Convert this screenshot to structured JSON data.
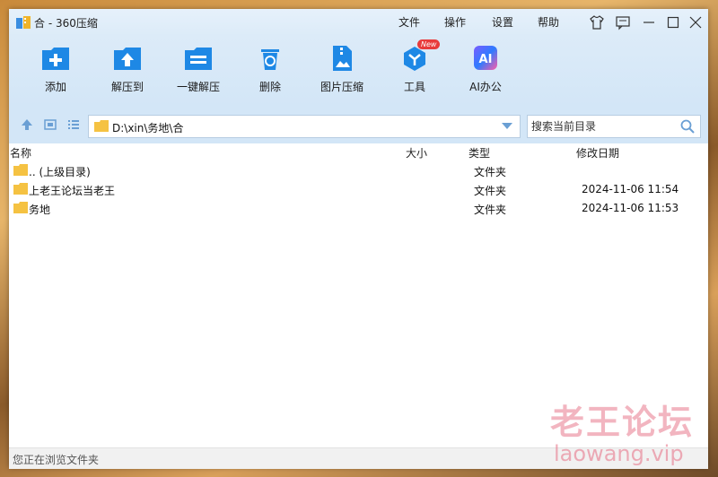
{
  "window": {
    "title": "合 - 360压缩",
    "menu": [
      "文件",
      "操作",
      "设置",
      "帮助"
    ]
  },
  "toolbar": {
    "items": [
      {
        "label": "添加",
        "icon": "add-icon"
      },
      {
        "label": "解压到",
        "icon": "extract-to-icon"
      },
      {
        "label": "一键解压",
        "icon": "one-click-extract-icon"
      },
      {
        "label": "删除",
        "icon": "delete-icon"
      },
      {
        "label": "图片压缩",
        "icon": "image-compress-icon"
      },
      {
        "label": "工具",
        "icon": "tools-icon",
        "badge": "New"
      },
      {
        "label": "AI办公",
        "icon": "ai-office-icon",
        "icon_text": "AI"
      }
    ]
  },
  "address": {
    "path": "D:\\xin\\务地\\合",
    "search_placeholder": "搜索当前目录"
  },
  "columns": {
    "name": "名称",
    "size": "大小",
    "type": "类型",
    "date": "修改日期"
  },
  "files": [
    {
      "name": ".. (上级目录)",
      "type": "文件夹",
      "date": ""
    },
    {
      "name": "上老王论坛当老王",
      "type": "文件夹",
      "date": "2024-11-06 11:54"
    },
    {
      "name": "务地",
      "type": "文件夹",
      "date": "2024-11-06 11:53"
    }
  ],
  "status": {
    "text": "您正在浏览文件夹"
  },
  "watermark": {
    "cn": "老王论坛",
    "en": "laowang.vip"
  },
  "colors": {
    "accent": "#1e88e5",
    "folder": "#f5c242",
    "titlebar": "#e6f1fb",
    "watermark": "#e8788c"
  }
}
